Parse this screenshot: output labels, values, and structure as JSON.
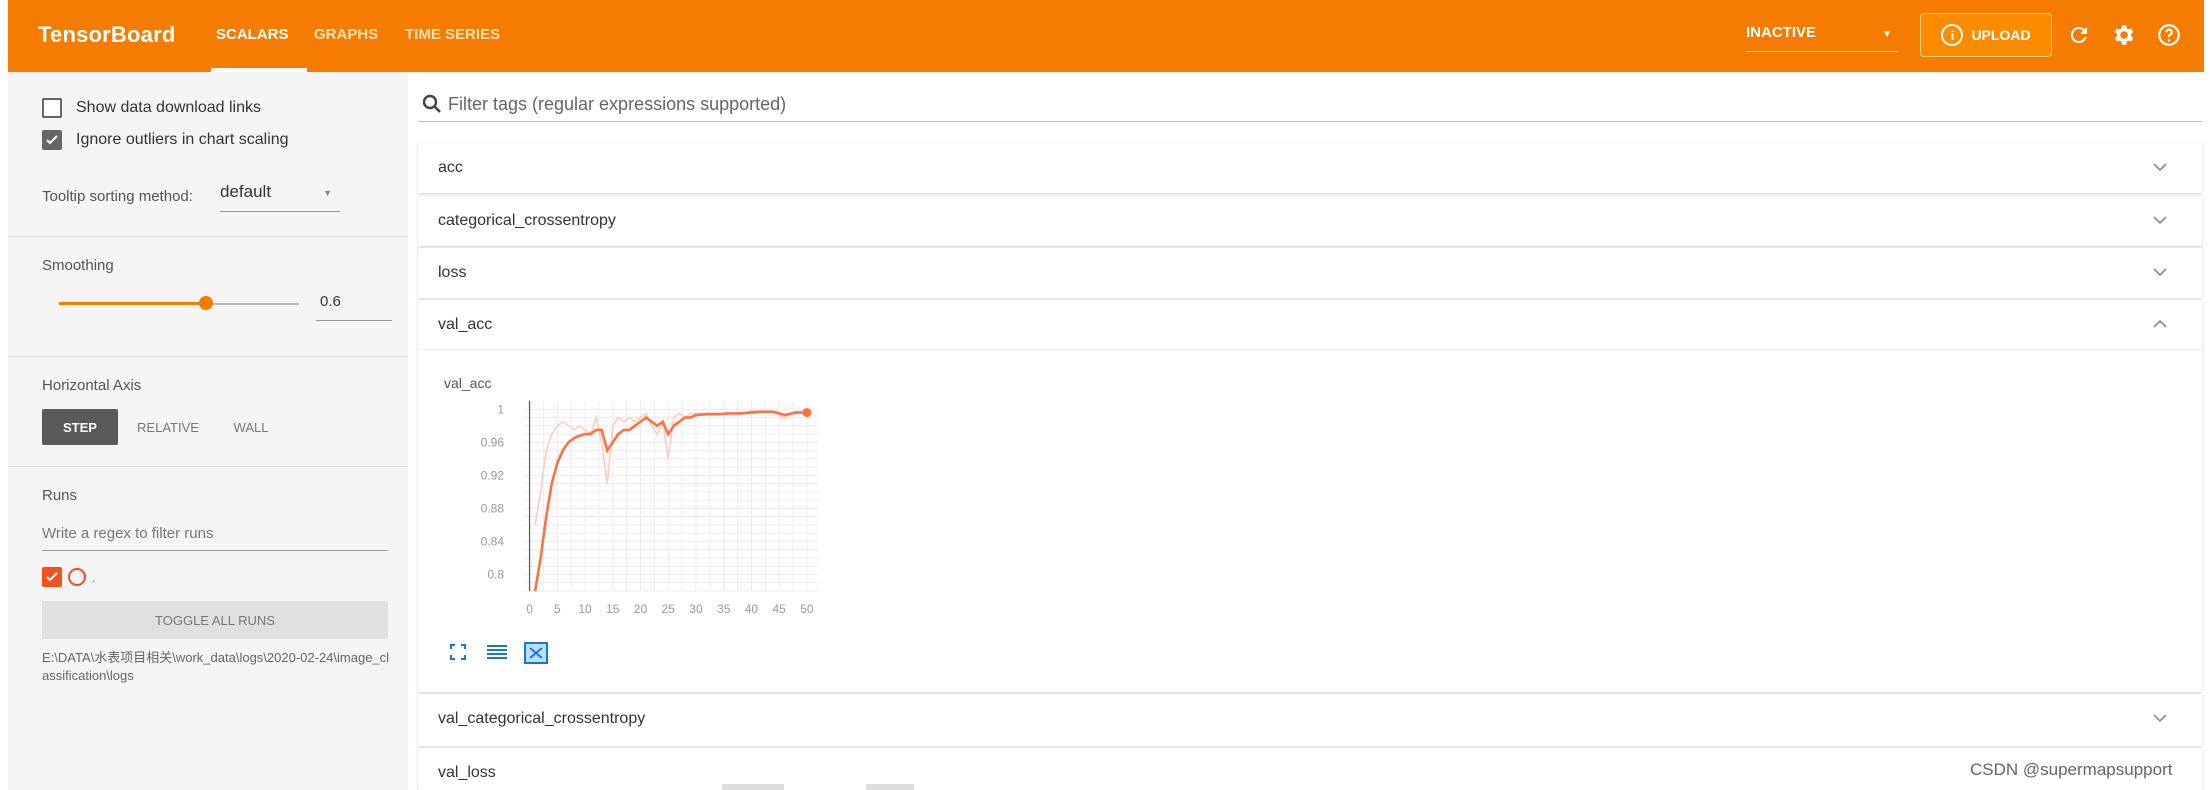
{
  "app": {
    "title": "TensorBoard",
    "tabs": [
      {
        "label": "SCALARS",
        "active": true
      },
      {
        "label": "GRAPHS",
        "active": false
      },
      {
        "label": "TIME SERIES",
        "active": false
      }
    ],
    "status_select": "INACTIVE",
    "upload_label": "UPLOAD",
    "upload_icon_text": "i",
    "accent_color": "#f57c00"
  },
  "sidebar": {
    "show_download_label": "Show data download links",
    "show_download_checked": false,
    "ignore_outliers_label": "Ignore outliers in chart scaling",
    "ignore_outliers_checked": true,
    "tooltip_label": "Tooltip sorting method:",
    "tooltip_value": "default",
    "smoothing_label": "Smoothing",
    "smoothing_value": "0.6",
    "horizontal_axis_label": "Horizontal Axis",
    "axis_options": [
      "STEP",
      "RELATIVE",
      "WALL"
    ],
    "axis_selected": "STEP",
    "runs_label": "Runs",
    "runs_filter_placeholder": "Write a regex to filter runs",
    "run_name": ".",
    "run_checked": true,
    "toggle_all_label": "TOGGLE ALL RUNS",
    "run_path": "E:\\DATA\\水表项目相关\\work_data\\logs\\2020-02-24\\image_classification\\logs"
  },
  "main": {
    "filter_placeholder": "Filter tags (regular expressions supported)",
    "cards": [
      {
        "title": "acc",
        "expanded": false
      },
      {
        "title": "categorical_crossentropy",
        "expanded": false
      },
      {
        "title": "loss",
        "expanded": false
      },
      {
        "title": "val_acc",
        "expanded": true
      },
      {
        "title": "val_categorical_crossentropy",
        "expanded": false
      },
      {
        "title": "val_loss",
        "expanded": false
      }
    ]
  },
  "chart_data": {
    "type": "line",
    "title": "val_acc",
    "xlabel": "",
    "ylabel": "",
    "xlim": [
      -1,
      52
    ],
    "ylim": [
      0.78,
      1.01
    ],
    "x_ticks": [
      0,
      5,
      10,
      15,
      20,
      25,
      30,
      35,
      40,
      45,
      50
    ],
    "y_ticks": [
      0.8,
      0.84,
      0.88,
      0.92,
      0.96,
      1
    ],
    "y_tick_labels": [
      "0.8",
      "0.84",
      "0.88",
      "0.92",
      "0.96",
      "1"
    ],
    "grid": true,
    "series": [
      {
        "color": "#ff7043",
        "raw_color": "#ffccbc",
        "raw": {
          "x": [
            1,
            2,
            3,
            4,
            5,
            6,
            7,
            8,
            9,
            10,
            11,
            12,
            13,
            14,
            15,
            16,
            17,
            18,
            19,
            20,
            21,
            22,
            23,
            24,
            25,
            26,
            27,
            28,
            29,
            30,
            32,
            34,
            36,
            38,
            40,
            42,
            44,
            46,
            48,
            50
          ],
          "y": [
            0.86,
            0.9,
            0.95,
            0.97,
            0.98,
            0.985,
            0.98,
            0.975,
            0.98,
            0.975,
            0.97,
            0.99,
            0.96,
            0.91,
            0.98,
            0.99,
            0.985,
            0.99,
            0.985,
            0.99,
            0.995,
            0.98,
            0.97,
            0.985,
            0.94,
            0.99,
            0.995,
            0.99,
            0.995,
            0.995,
            0.995,
            0.995,
            0.995,
            0.995,
            0.998,
            0.998,
            0.996,
            0.99,
            0.998,
            0.995
          ]
        },
        "smoothed": {
          "x": [
            1,
            2,
            3,
            4,
            5,
            6,
            7,
            8,
            9,
            10,
            11,
            12,
            13,
            14,
            15,
            16,
            17,
            18,
            19,
            20,
            21,
            22,
            23,
            24,
            25,
            26,
            27,
            28,
            29,
            30,
            32,
            34,
            36,
            38,
            40,
            42,
            44,
            46,
            48,
            50
          ],
          "y": [
            0.78,
            0.82,
            0.87,
            0.91,
            0.935,
            0.95,
            0.96,
            0.965,
            0.968,
            0.97,
            0.97,
            0.975,
            0.975,
            0.95,
            0.96,
            0.97,
            0.975,
            0.975,
            0.98,
            0.985,
            0.99,
            0.985,
            0.98,
            0.985,
            0.97,
            0.98,
            0.985,
            0.99,
            0.99,
            0.993,
            0.994,
            0.994,
            0.995,
            0.995,
            0.996,
            0.997,
            0.997,
            0.993,
            0.996,
            0.996
          ]
        }
      }
    ]
  },
  "watermark": "CSDN @supermapsupport"
}
